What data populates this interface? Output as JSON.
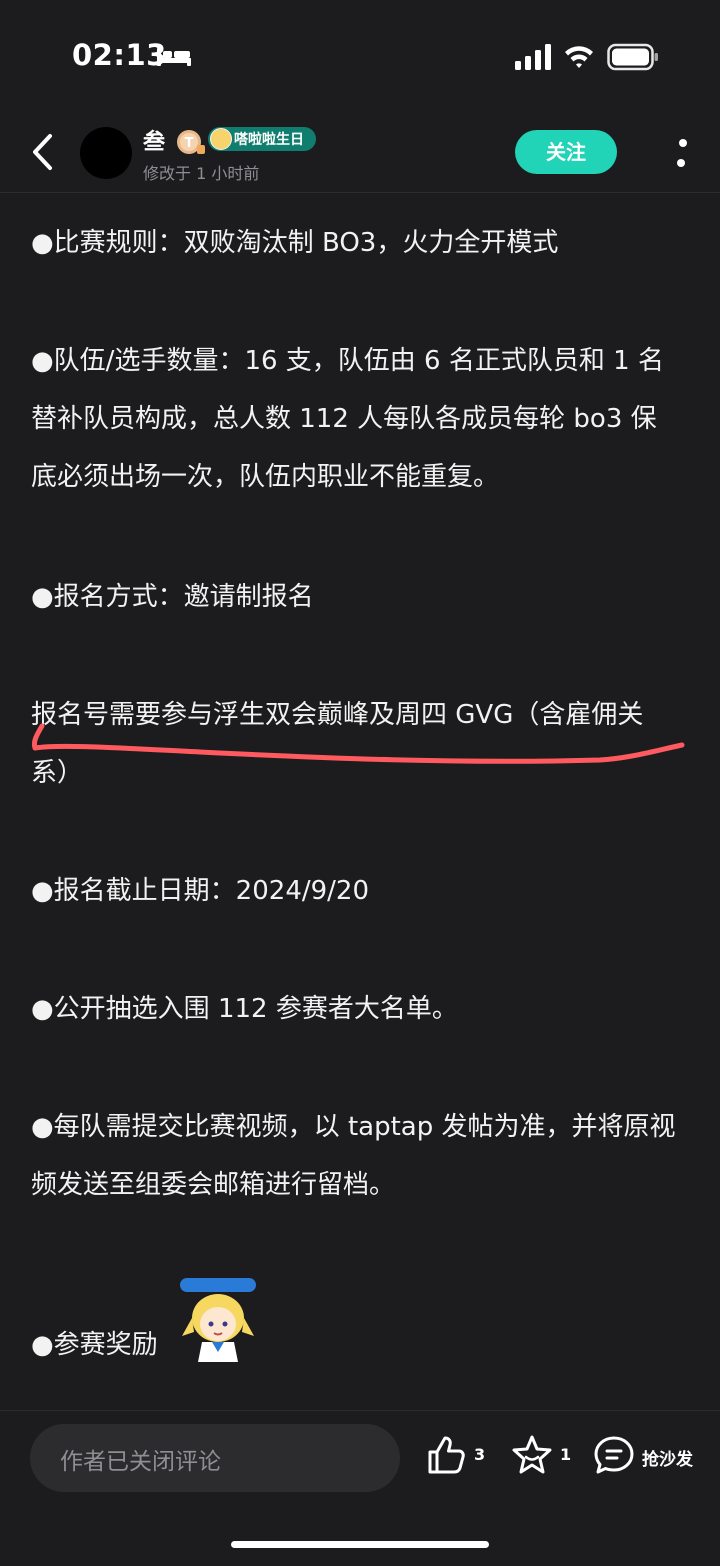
{
  "status_bar": {
    "time": "02:13"
  },
  "header": {
    "author_name": "叁",
    "event_badge": "嗒啦啦生日",
    "edit_time": "修改于 1 小时前",
    "follow_label": "关注"
  },
  "content": {
    "rules": "●比赛规则：双败淘汰制 BO3，火力全开模式",
    "team_count": "●队伍/选手数量：16 支，队伍由 6 名正式队员和 1 名替补队员构成，总人数 112 人每队各成员每轮 bo3 保底必须出场一次，队伍内职业不能重复。",
    "signup_method": "●报名方式：邀请制报名",
    "signup_requirement": "报名号需要参与浮生双会巅峰及周四 GVG（含雇佣关系）",
    "deadline": "●报名截止日期：2024/9/20",
    "public_draw": "●公开抽选入围 112 参赛者大名单。",
    "video_rule": "●每队需提交比赛视频，以 taptap 发帖为准，并将原视频发送至组委会邮箱进行留档。",
    "rewards": "●参赛奖励",
    "underline_color": "#ff5a5f"
  },
  "bottom_bar": {
    "comment_placeholder": "作者已关闭评论",
    "like_count": "3",
    "favorite_count": "1",
    "sofa_label": "抢沙发"
  },
  "icons": {
    "back": "chevron-left-icon",
    "more": "more-vertical-icon",
    "like": "thumbs-up-icon",
    "favorite": "star-icon",
    "comment": "comment-bubble-icon"
  },
  "colors": {
    "accent": "#21d3b7",
    "background": "#1c1c1e"
  }
}
